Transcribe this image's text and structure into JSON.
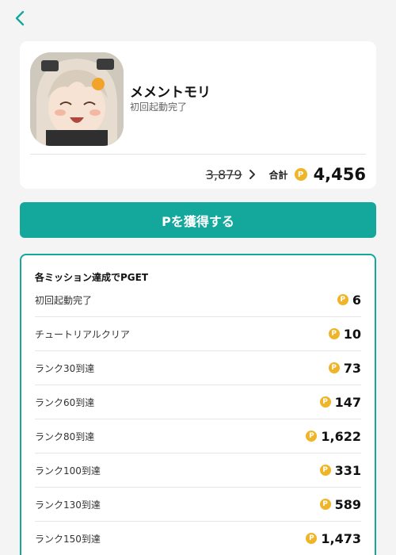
{
  "app": {
    "name": "メメントモリ",
    "status": "初回起動完了",
    "old_points": "3,879",
    "total_label": "合計",
    "total_points": "4,456"
  },
  "icons": {
    "back": "chevron-left-icon",
    "arrow": "chevron-right-icon",
    "coin": "coin-icon",
    "coin_letter": "P"
  },
  "colors": {
    "accent": "#14a89d",
    "coin": "#f0b429",
    "background": "#f4f4f4"
  },
  "get_button": {
    "label": "Pを獲得する"
  },
  "missions": {
    "title": "各ミッション達成でPGET",
    "items": [
      {
        "label": "初回起動完了",
        "points": "6"
      },
      {
        "label": "チュートリアルクリア",
        "points": "10"
      },
      {
        "label": "ランク30到達",
        "points": "73"
      },
      {
        "label": "ランク60到達",
        "points": "147"
      },
      {
        "label": "ランク80到達",
        "points": "1,622"
      },
      {
        "label": "ランク100到達",
        "points": "331"
      },
      {
        "label": "ランク130到達",
        "points": "589"
      },
      {
        "label": "ランク150到達",
        "points": "1,473"
      }
    ]
  }
}
